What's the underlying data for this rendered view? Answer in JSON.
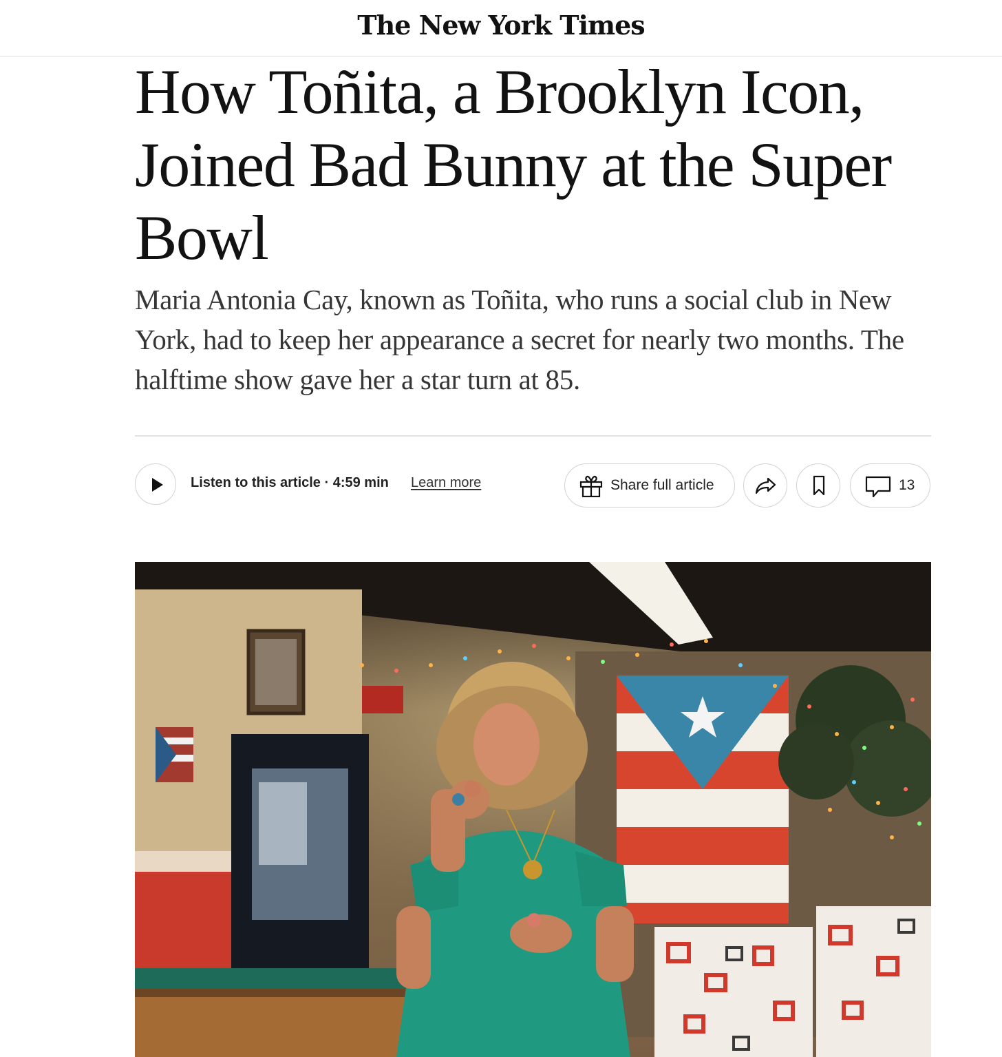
{
  "masthead": {
    "logo_text": "The New York Times"
  },
  "article": {
    "headline": "How Toñita, a Brooklyn Icon, Joined Bad Bunny at the Super Bowl",
    "summary": "Maria Antonia Cay, known as Toñita, who runs a social club in New York, had to keep her appearance a secret for nearly two months. The halftime show gave her a star turn at 85."
  },
  "toolbar": {
    "listen_label": "Listen to this article · 4:59 min",
    "learn_more": "Learn more",
    "share_full_label": "Share full article",
    "comment_count": "13"
  },
  "icons": {
    "play": "play-icon",
    "gift": "gift-icon",
    "share": "share-arrow-icon",
    "bookmark": "bookmark-icon",
    "comment": "comment-icon"
  },
  "colors": {
    "text": "#121212",
    "summary_text": "#363636",
    "border": "#d2d2d2",
    "dress": "#1f9a80",
    "flag_red": "#d8452e",
    "flag_blue": "#3a86a8"
  }
}
